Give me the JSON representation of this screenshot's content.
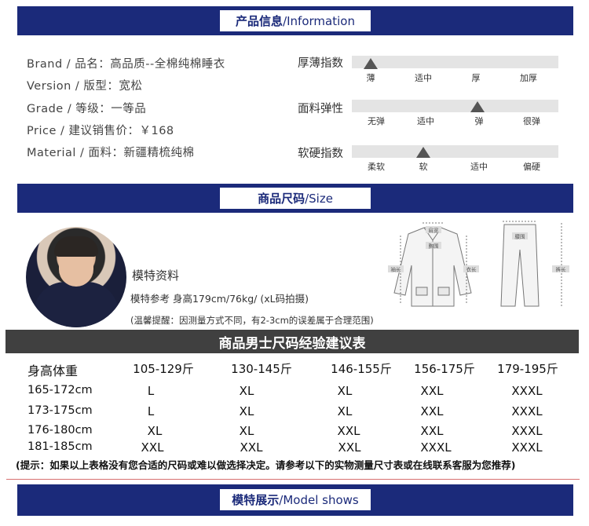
{
  "banners": {
    "information": {
      "bold": "产品信息",
      "plain": "/Information"
    },
    "size": {
      "bold": "商品尺码",
      "plain": "/Size"
    },
    "model_shows": {
      "bold": "模特展示",
      "plain": "/Model shows"
    }
  },
  "product_info": [
    "Brand / 品名：高品质--全棉纯棉睡衣",
    "Version / 版型：宽松",
    "Grade / 等级：一等品",
    "Price / 建议销售价：￥168",
    "Material / 面料：新疆精梳纯棉"
  ],
  "scales": [
    {
      "label": "厚薄指数",
      "ticks": [
        "薄",
        "适中",
        "厚",
        "加厚"
      ],
      "selected": "薄"
    },
    {
      "label": "面料弹性",
      "ticks": [
        "无弹",
        "适中",
        "弹",
        "很弹"
      ],
      "selected": "弹"
    },
    {
      "label": "软硬指数",
      "ticks": [
        "柔软",
        "软",
        "适中",
        "偏硬"
      ],
      "selected": "软"
    }
  ],
  "model": {
    "title": "模特资料",
    "line": "模特参考  身高179cm/76kg/     (xL码拍摄)",
    "note": "(温馨提醒：因测量方式不同，有2-3cm的误差属于合理范围)"
  },
  "diagram_labels": {
    "shoulder": "肩宽",
    "chest": "胸围",
    "sleeve": "袖长",
    "length": "衣长",
    "waist": "腰围",
    "pants_length": "裤长"
  },
  "size_table": {
    "title": "商品男士尺码经验建议表",
    "header": [
      "身高体重",
      "105-129斤",
      "130-145斤",
      "146-155斤",
      "156-175斤",
      "179-195斤"
    ],
    "rows": [
      [
        "165-172cm",
        "L",
        "XL",
        "XL",
        "XXL",
        "XXXL"
      ],
      [
        "173-175cm",
        "L",
        "XL",
        "XL",
        "XXL",
        "XXXL"
      ],
      [
        "176-180cm",
        "XL",
        "XL",
        "XXL",
        "XXL",
        "XXXL"
      ],
      [
        "181-185cm",
        "XXL",
        "XXL",
        "XXL",
        "XXXL",
        "XXXL"
      ]
    ]
  },
  "tip": "(提示：如果以上表格没有您合适的尺码或难以做选择决定。请参考以下的实物测量尺寸表或在线联系客服为您推荐)",
  "colors": {
    "navy": "#1b2a7a",
    "dark_gray": "#404040",
    "scale_bar": "#e4e4e4"
  }
}
